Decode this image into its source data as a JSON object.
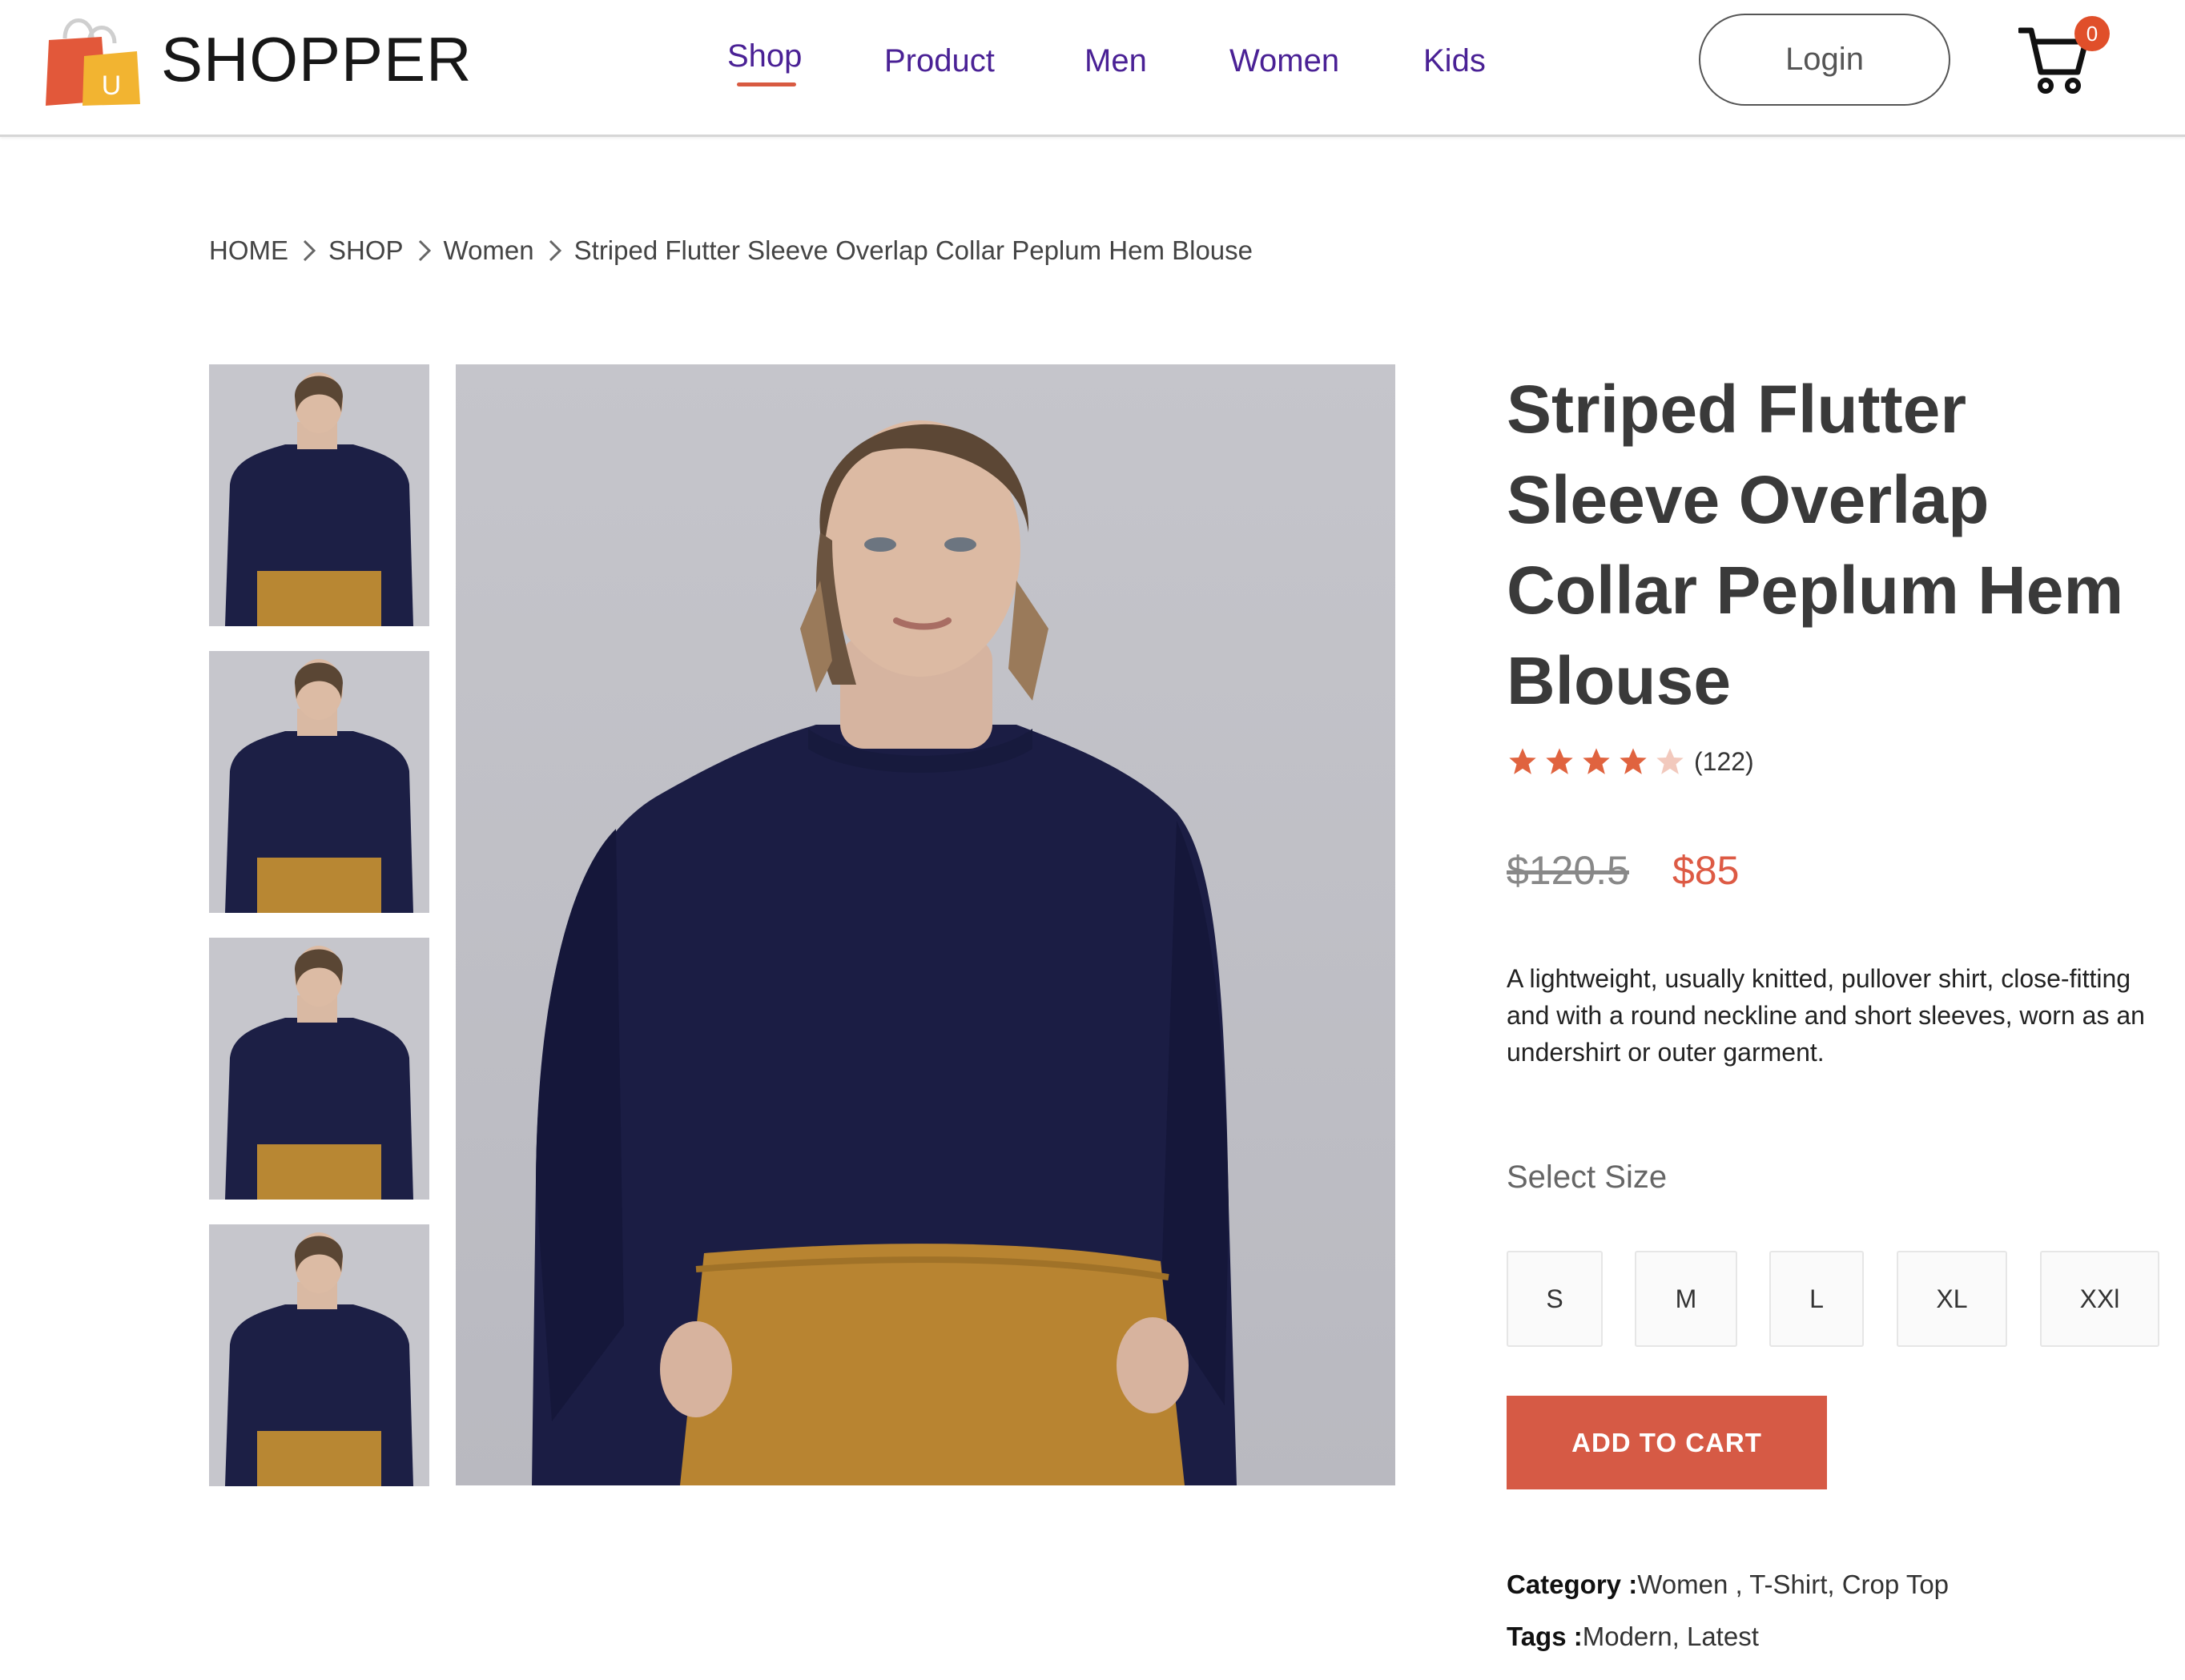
{
  "brand": {
    "name": "SHOPPER",
    "logo_letter": "U"
  },
  "nav": {
    "links": [
      {
        "label": "Shop",
        "active": true
      },
      {
        "label": "Product",
        "active": false
      },
      {
        "label": "Men",
        "active": false
      },
      {
        "label": "Women",
        "active": false
      },
      {
        "label": "Kids",
        "active": false
      }
    ],
    "login_label": "Login",
    "cart_count": "0"
  },
  "breadcrumb": {
    "items": [
      "HOME",
      "SHOP",
      "Women"
    ],
    "current": "Striped Flutter Sleeve Overlap Collar Peplum Hem Blouse"
  },
  "product": {
    "title": "Striped Flutter Sleeve Overlap Collar Peplum Hem Blouse",
    "rating": {
      "stars": 4,
      "out_of": 5,
      "count": "(122)"
    },
    "price_old": "$120.5",
    "price_new": "$85",
    "description": "A lightweight, usually knitted, pullover shirt, close-fitting and with a round neckline and short sleeves, worn as an undershirt or outer garment.",
    "size_label": "Select Size",
    "sizes": [
      "S",
      "M",
      "L",
      "XL",
      "XXl"
    ],
    "add_to_cart": "ADD TO CART",
    "category_key": "Category :",
    "category_value": "Women , T-Shirt, Crop Top",
    "tags_key": "Tags :",
    "tags_value": "Modern, Latest"
  },
  "colors": {
    "nav_link": "#4a2195",
    "accent": "#d65a45",
    "star": "#e0633f",
    "star_empty": "#f2c9bd",
    "badge": "#e04f2a"
  },
  "icons": {
    "logo": "shopping-bags-icon",
    "cart": "shopping-cart-icon",
    "breadcrumb_separator": "chevron-right-icon",
    "rating": "star-icon"
  }
}
